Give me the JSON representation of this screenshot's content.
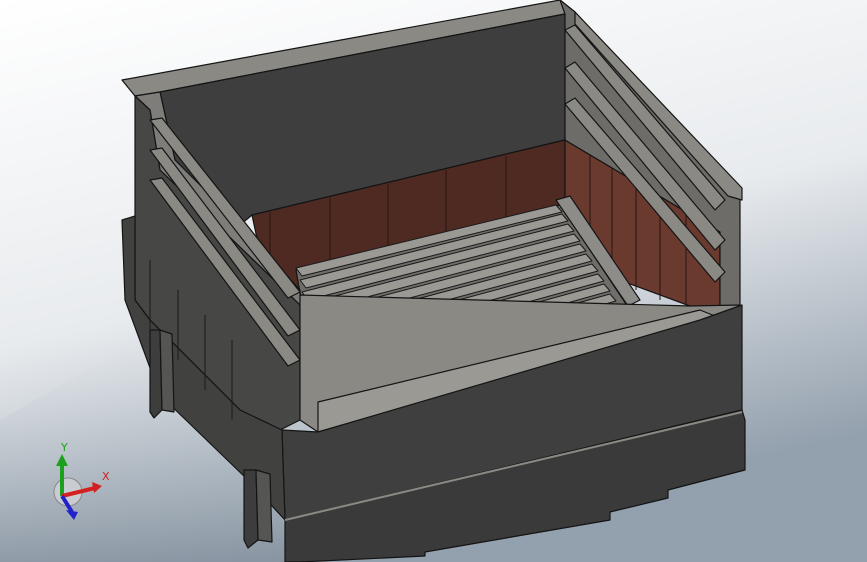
{
  "viewport": {
    "background_top": "#ffffff",
    "background_bottom": "#93a0ad"
  },
  "model": {
    "body_color": "#3d3d3d",
    "edge_color": "#141414",
    "rim_color": "#8a8984",
    "brick_color": "#4e2a22",
    "brick_light": "#6a3a2f",
    "grate_color": "#8d8c88"
  },
  "triad": {
    "x_label": "X",
    "y_label": "Y",
    "x_color": "#d42020",
    "y_color": "#1da01d",
    "z_color": "#2222cc"
  }
}
